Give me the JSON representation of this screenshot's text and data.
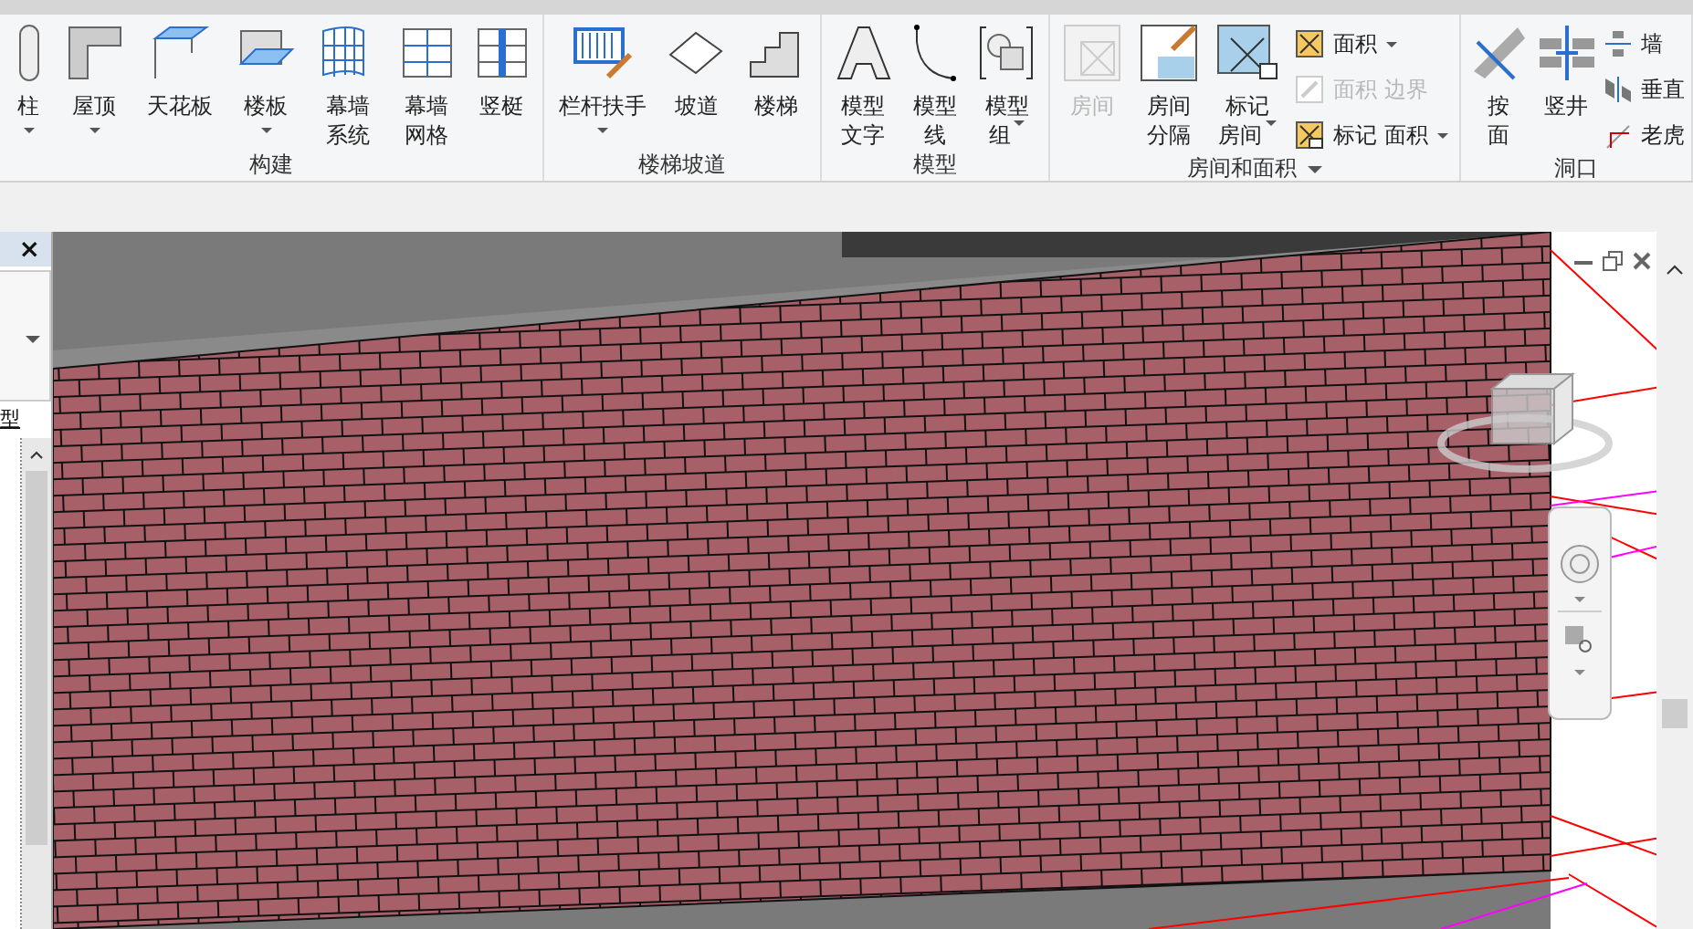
{
  "ribbon": {
    "groups": [
      {
        "title": "构建",
        "menu": false,
        "tools": [
          {
            "kind": "large",
            "lines": [
              "柱"
            ],
            "dropdown": true,
            "disabled": false
          },
          {
            "kind": "large",
            "lines": [
              "屋顶"
            ],
            "dropdown": true,
            "disabled": false
          },
          {
            "kind": "large",
            "lines": [
              "天花板"
            ],
            "dropdown": false,
            "disabled": false
          },
          {
            "kind": "large",
            "lines": [
              "楼板"
            ],
            "dropdown": true,
            "disabled": false
          },
          {
            "kind": "large",
            "lines": [
              "幕墙",
              "系统"
            ],
            "dropdown": false,
            "disabled": false
          },
          {
            "kind": "large",
            "lines": [
              "幕墙",
              "网格"
            ],
            "dropdown": false,
            "disabled": false
          },
          {
            "kind": "large",
            "lines": [
              "竖梃"
            ],
            "dropdown": false,
            "disabled": false
          }
        ]
      },
      {
        "title": "楼梯坡道",
        "menu": false,
        "tools": [
          {
            "kind": "large",
            "lines": [
              "栏杆扶手"
            ],
            "dropdown": true,
            "disabled": false
          },
          {
            "kind": "large",
            "lines": [
              "坡道"
            ],
            "dropdown": false,
            "disabled": false
          },
          {
            "kind": "large",
            "lines": [
              "楼梯"
            ],
            "dropdown": false,
            "disabled": false
          }
        ]
      },
      {
        "title": "模型",
        "menu": false,
        "tools": [
          {
            "kind": "large",
            "lines": [
              "模型",
              "文字"
            ],
            "dropdown": false,
            "disabled": false
          },
          {
            "kind": "large",
            "lines": [
              "模型",
              "线"
            ],
            "dropdown": false,
            "disabled": false
          },
          {
            "kind": "large",
            "lines": [
              "模型",
              "组"
            ],
            "dropdown": true,
            "disabled": false
          }
        ]
      },
      {
        "title": "房间和面积",
        "menu": true,
        "tools": [
          {
            "kind": "large",
            "lines": [
              "房间"
            ],
            "dropdown": false,
            "disabled": true
          },
          {
            "kind": "large",
            "lines": [
              "房间",
              "分隔"
            ],
            "dropdown": false,
            "disabled": false
          },
          {
            "kind": "large",
            "lines": [
              "标记",
              "房间"
            ],
            "dropdown": true,
            "disabled": false
          },
          {
            "kind": "stack",
            "rows": [
              {
                "parts": [
                  "面积"
                ],
                "dropdown": true,
                "disabled": false
              },
              {
                "parts": [
                  "面积",
                  "边界"
                ],
                "dropdown": false,
                "disabled": true
              },
              {
                "parts": [
                  "标记",
                  "面积"
                ],
                "dropdown": true,
                "disabled": false
              }
            ]
          }
        ]
      },
      {
        "title": "洞口",
        "menu": false,
        "tools": [
          {
            "kind": "large",
            "lines": [
              "按",
              "面"
            ],
            "dropdown": false,
            "disabled": false
          },
          {
            "kind": "large",
            "lines": [
              "竖井"
            ],
            "dropdown": false,
            "disabled": false
          },
          {
            "kind": "stack",
            "rows": [
              {
                "parts": [
                  "墙"
                ],
                "dropdown": false,
                "disabled": false
              },
              {
                "parts": [
                  "垂直"
                ],
                "dropdown": false,
                "disabled": false
              },
              {
                "parts": [
                  "老虎"
                ],
                "dropdown": false,
                "disabled": false
              }
            ]
          }
        ]
      }
    ]
  },
  "left_panel": {
    "close": "×",
    "type_label": "型"
  }
}
